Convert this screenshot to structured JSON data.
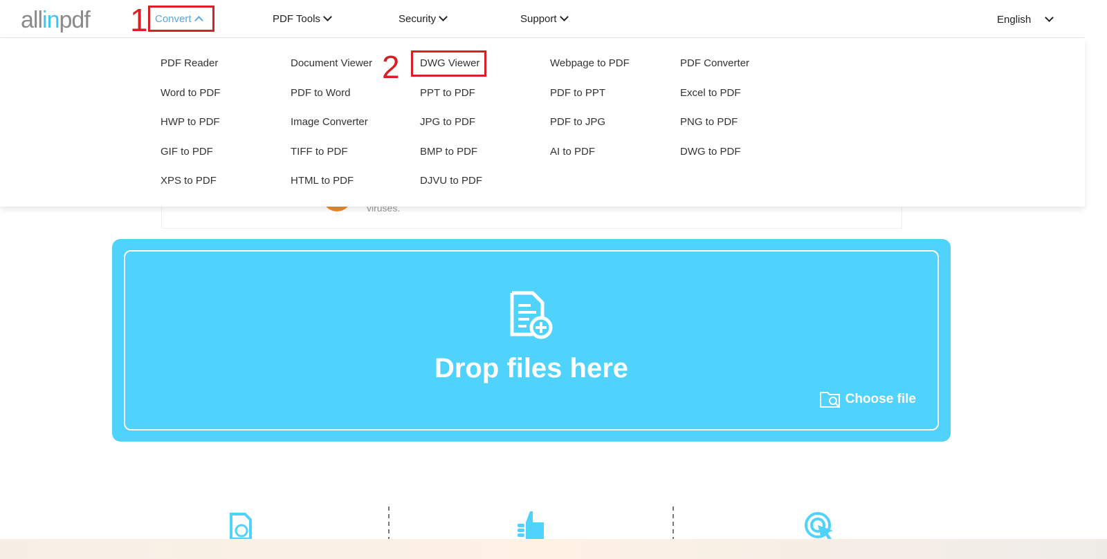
{
  "header": {
    "logo": {
      "part1": "all",
      "part2": "in",
      "part3": "pdf"
    },
    "nav": [
      {
        "label": "Convert",
        "state": "expanded"
      },
      {
        "label": "PDF Tools"
      },
      {
        "label": "Security"
      },
      {
        "label": "Support"
      }
    ],
    "language": "English"
  },
  "annotations": {
    "step1": "1",
    "step2": "2",
    "color": "#d91f26"
  },
  "menu": {
    "columns": [
      [
        "PDF Reader",
        "Word to PDF",
        "HWP to PDF",
        "GIF to PDF",
        "XPS to PDF"
      ],
      [
        "Document Viewer",
        "PDF to Word",
        "Image Converter",
        "TIFF to PDF",
        "HTML to PDF"
      ],
      [
        "DWG Viewer",
        "PPT to PDF",
        "JPG to PDF",
        "BMP to PDF",
        "DJVU to PDF"
      ],
      [
        "Webpage to PDF",
        "PDF to PPT",
        "PDF to JPG",
        "AI to PDF"
      ],
      [
        "PDF Converter",
        "Excel to PDF",
        "PNG to PDF",
        "DWG to PDF"
      ]
    ]
  },
  "notice": {
    "text": "viruses."
  },
  "dropzone": {
    "title": "Drop files here",
    "choose": "Choose file",
    "color": "#4fd2fc",
    "icon": "file-add-icon"
  },
  "features": [
    {
      "icon": "pdf-search-icon"
    },
    {
      "icon": "thumbs-up-icon"
    },
    {
      "icon": "click-icon"
    }
  ]
}
